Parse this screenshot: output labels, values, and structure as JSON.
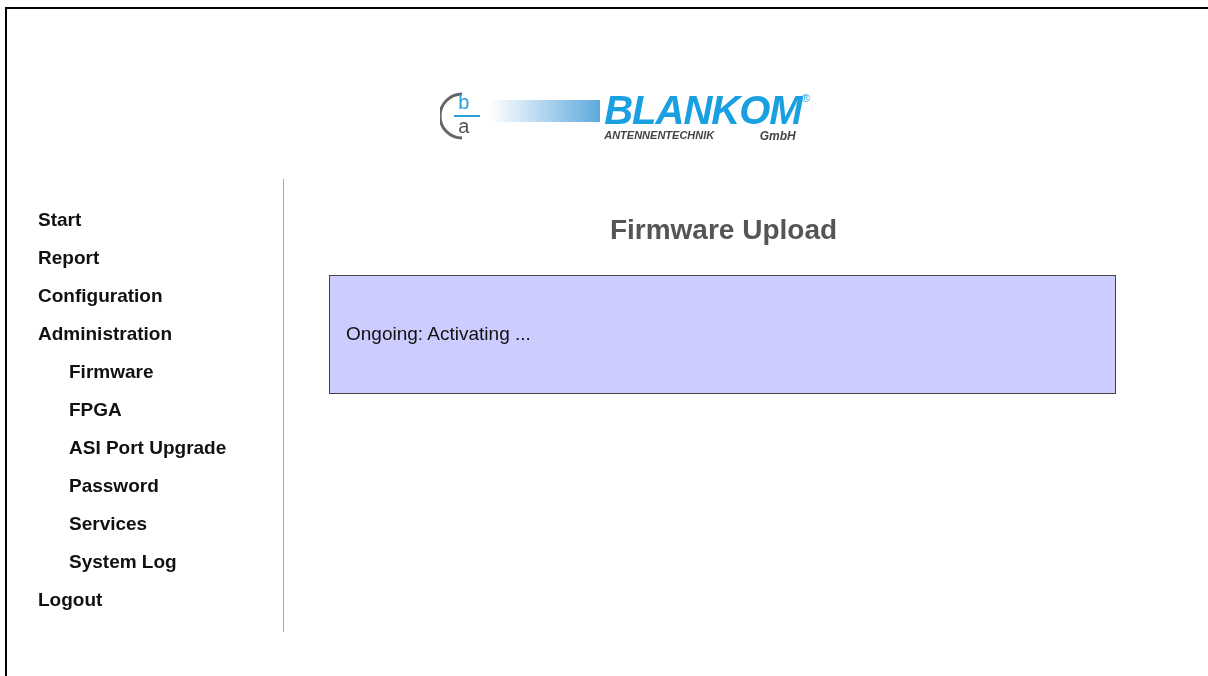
{
  "logo": {
    "mark_top": "b",
    "mark_bottom": "a",
    "name": "BLANKOM",
    "registered": "®",
    "subtitle": "ANTENNENTECHNIK",
    "company_form": "GmbH"
  },
  "sidebar": {
    "items": [
      {
        "label": "Start"
      },
      {
        "label": "Report"
      },
      {
        "label": "Configuration"
      },
      {
        "label": "Administration",
        "children": [
          {
            "label": "Firmware"
          },
          {
            "label": "FPGA"
          },
          {
            "label": "ASI Port Upgrade"
          },
          {
            "label": "Password"
          },
          {
            "label": "Services"
          },
          {
            "label": "System Log"
          }
        ]
      },
      {
        "label": "Logout"
      }
    ]
  },
  "main": {
    "title": "Firmware Upload",
    "status_message": "Ongoing: Activating ..."
  }
}
